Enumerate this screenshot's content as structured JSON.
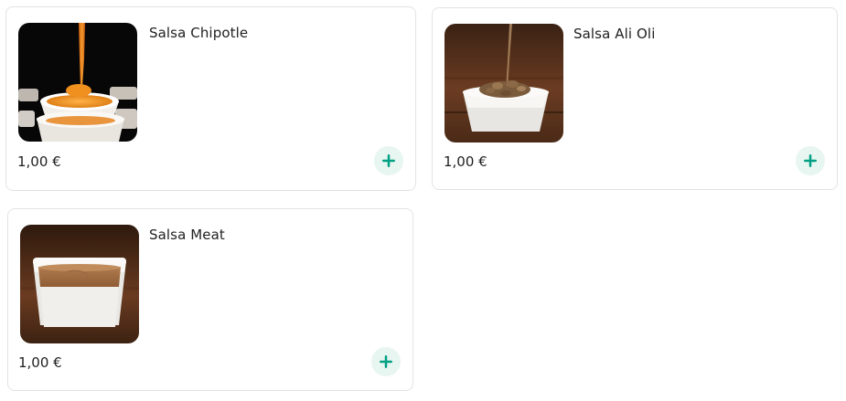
{
  "products": [
    {
      "name": "Salsa Chipotle",
      "price": "1,00 €",
      "image_icon": "salsa-chipotle-image"
    },
    {
      "name": "Salsa Ali Oli",
      "price": "1,00 €",
      "image_icon": "salsa-ali-oli-image"
    },
    {
      "name": "Salsa Meat",
      "price": "1,00 €",
      "image_icon": "salsa-meat-image"
    }
  ],
  "colors": {
    "add_button_bg": "#e8f6f2",
    "add_button_icon": "#00a082",
    "card_border": "#e3e3e3"
  }
}
